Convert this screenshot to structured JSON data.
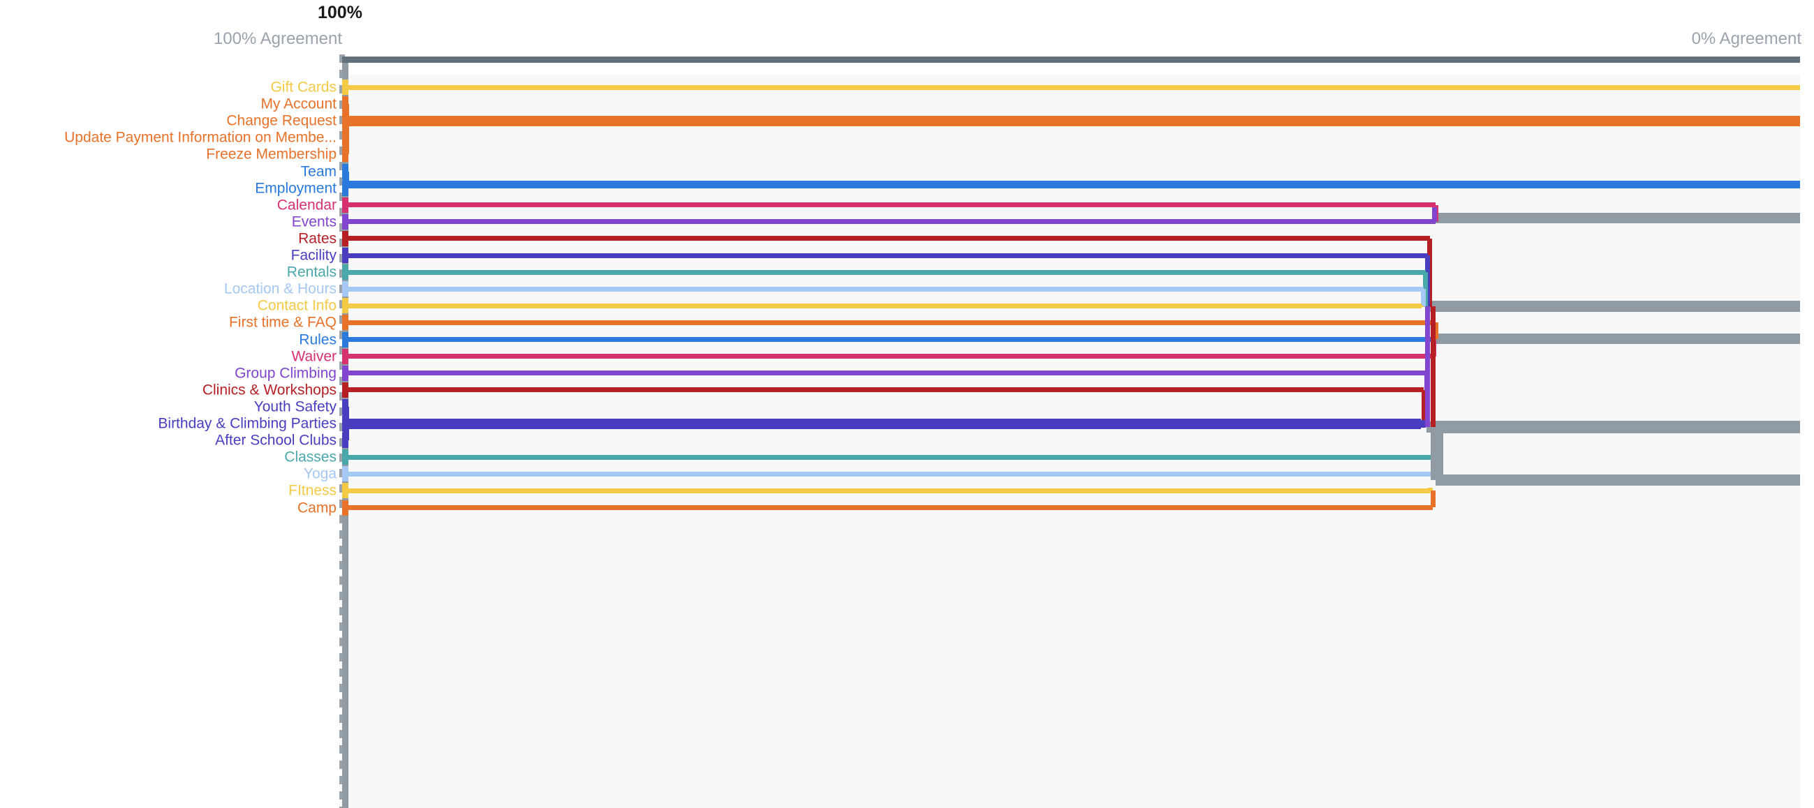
{
  "header": {
    "scale_top_label": "100%",
    "left_axis_label": "100% Agreement",
    "right_axis_label": "0% Agreement"
  },
  "chart_data": {
    "type": "dendrogram",
    "title": "",
    "xlabel": "Agreement",
    "ylabel": "",
    "axis_left_value": "100%",
    "axis_right_value": "0%",
    "xlim": [
      100,
      0
    ],
    "grid": false,
    "legend": "none",
    "merge_color": "#919ba4",
    "plot_background": "#f8f8f8",
    "axis_color": "#9aa3ab",
    "root_color": "#63707a",
    "leaves": [
      {
        "index": 0,
        "label": "Gift Cards",
        "color": "#f5ca47",
        "merge_x_pct": 0
      },
      {
        "index": 1,
        "label": "My Account",
        "color": "#e8722a",
        "merge_x_pct": 100
      },
      {
        "index": 2,
        "label": "Change Request",
        "color": "#e8722a",
        "merge_x_pct": 0
      },
      {
        "index": 3,
        "label": "Update Payment Information on Membe...",
        "color": "#e8722a",
        "merge_x_pct": 100
      },
      {
        "index": 4,
        "label": "Freeze Membership",
        "color": "#e8722a",
        "merge_x_pct": 100
      },
      {
        "index": 5,
        "label": "Team",
        "color": "#2a7ade",
        "merge_x_pct": 100
      },
      {
        "index": 6,
        "label": "Employment",
        "color": "#2a7ade",
        "merge_x_pct": 0
      },
      {
        "index": 7,
        "label": "Calendar",
        "color": "#d6326f",
        "merge_x_pct": 75
      },
      {
        "index": 8,
        "label": "Events",
        "color": "#8145d0",
        "merge_x_pct": 75
      },
      {
        "index": 9,
        "label": "Rates",
        "color": "#b62025",
        "merge_x_pct": 26
      },
      {
        "index": 10,
        "label": "Facility",
        "color": "#4a3ec0",
        "merge_x_pct": 26
      },
      {
        "index": 11,
        "label": "Rentals",
        "color": "#4aa8aa",
        "merge_x_pct": 26
      },
      {
        "index": 12,
        "label": "Location & Hours",
        "color": "#a5c8f5",
        "merge_x_pct": 26
      },
      {
        "index": 13,
        "label": "Contact Info",
        "color": "#f5ca47",
        "merge_x_pct": 26
      },
      {
        "index": 14,
        "label": "First time & FAQ",
        "color": "#e8722a",
        "merge_x_pct": 75
      },
      {
        "index": 15,
        "label": "Rules",
        "color": "#2a7ade",
        "merge_x_pct": 75
      },
      {
        "index": 16,
        "label": "Waiver",
        "color": "#d6326f",
        "merge_x_pct": 75
      },
      {
        "index": 17,
        "label": "Group Climbing",
        "color": "#8145d0",
        "merge_x_pct": 26
      },
      {
        "index": 18,
        "label": "Clinics & Workshops",
        "color": "#b62025",
        "merge_x_pct": 26
      },
      {
        "index": 19,
        "label": "Youth Safety",
        "color": "#4a3ec0",
        "merge_x_pct": 100
      },
      {
        "index": 20,
        "label": "Birthday & Climbing Parties",
        "color": "#4a3ec0",
        "merge_x_pct": 26
      },
      {
        "index": 21,
        "label": "After School Clubs",
        "color": "#4a3ec0",
        "merge_x_pct": 100
      },
      {
        "index": 22,
        "label": "Classes",
        "color": "#4aa8aa",
        "merge_x_pct": 75
      },
      {
        "index": 23,
        "label": "Yoga",
        "color": "#a5c8f5",
        "merge_x_pct": 75
      },
      {
        "index": 24,
        "label": "FItness",
        "color": "#f5ca47",
        "merge_x_pct": 75
      },
      {
        "index": 25,
        "label": "Camp",
        "color": "#e8722a",
        "merge_x_pct": 75
      }
    ],
    "merges": [
      {
        "name": "calendar-events",
        "members": [
          "Calendar",
          "Events"
        ],
        "x_pct": 75,
        "color": "#919ba4"
      },
      {
        "name": "faq-rules-waiver",
        "members": [
          "First time & FAQ",
          "Rules",
          "Waiver"
        ],
        "x_pct": 75,
        "color": "#919ba4"
      },
      {
        "name": "classes-yoga-fitness-camp",
        "members": [
          "Classes",
          "Yoga",
          "FItness",
          "Camp"
        ],
        "x_pct": 75,
        "color": "#919ba4"
      },
      {
        "name": "facility-cluster",
        "members": [
          "Rates",
          "Facility",
          "Rentals",
          "Location & Hours",
          "Contact Info"
        ],
        "x_pct": 26,
        "color": "#919ba4"
      },
      {
        "name": "programs-cluster",
        "members": [
          "Group Climbing",
          "Clinics & Workshops",
          "Birthday & Climbing Parties"
        ],
        "x_pct": 26,
        "color": "#919ba4"
      },
      {
        "name": "root",
        "members": [
          "all"
        ],
        "x_pct": 100,
        "color": "#63707a"
      }
    ]
  }
}
